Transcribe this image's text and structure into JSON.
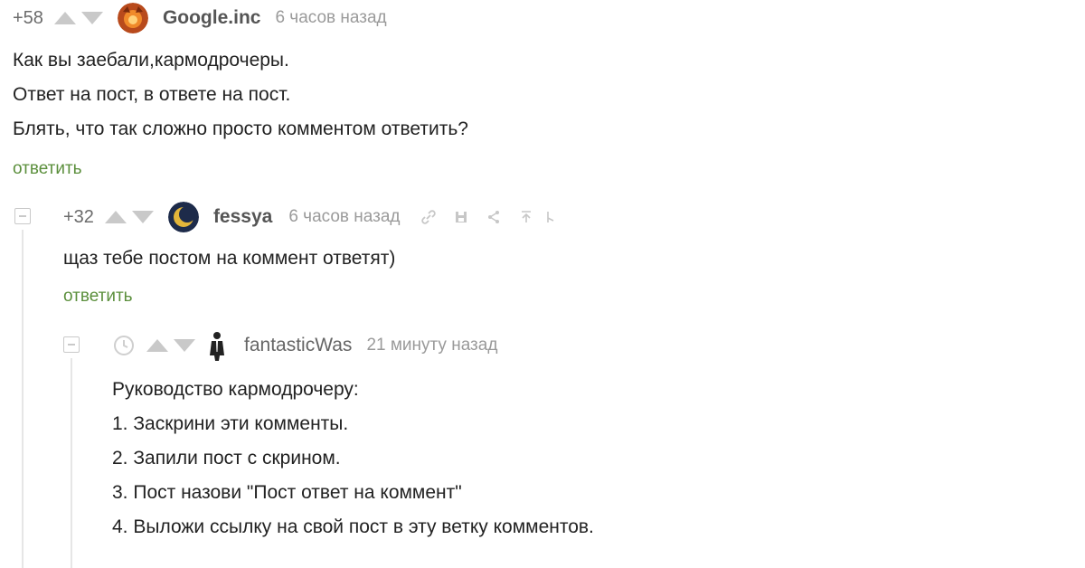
{
  "comments": [
    {
      "rating": "+58",
      "author": "Google.inc",
      "time": "6 часов назад",
      "lines": [
        "Как вы заебали,кармодрочеры.",
        "Ответ на пост, в ответе на пост.",
        "Блять, что так сложно просто комментом ответить?"
      ],
      "reply_label": "ответить"
    },
    {
      "rating": "+32",
      "author": "fessya",
      "time": "6 часов назад",
      "lines": [
        "щаз тебе постом на коммент ответят)"
      ],
      "reply_label": "ответить",
      "tools": [
        "link-icon",
        "save-icon",
        "share-icon",
        "scroll-up-icon",
        "more-icon"
      ]
    },
    {
      "author": "fantasticWas",
      "time": "21 минуту назад",
      "heading": "Руководство кармодрочеру:",
      "lines": [
        "1. Заскрини эти комменты.",
        "2. Запили пост с скрином.",
        "3. Пост назови \"Пост ответ на коммент\"",
        "4. Выложи ссылку на свой пост в эту ветку комментов."
      ]
    }
  ],
  "colors": {
    "reply_link": "#5b8f3c",
    "meta_text": "#9a9a9a",
    "arrows": "#c9c9c9"
  }
}
